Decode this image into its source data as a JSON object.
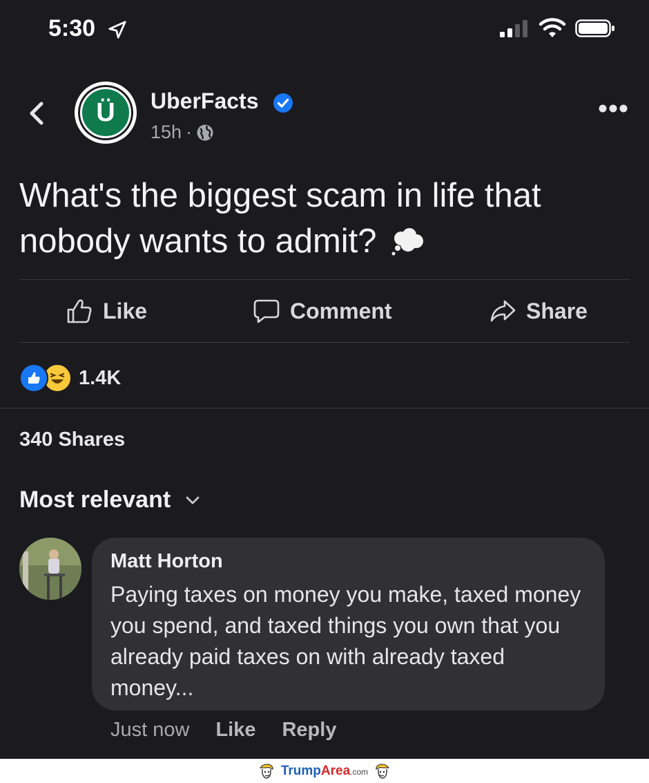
{
  "status_bar": {
    "time": "5:30"
  },
  "post": {
    "author": "UberFacts",
    "avatar_letter": "Ü",
    "time": "15h",
    "separator": "·",
    "text": "What's the biggest scam in life that nobody wants to admit?",
    "actions": {
      "like": "Like",
      "comment": "Comment",
      "share": "Share"
    },
    "reaction_count": "1.4K",
    "shares": "340 Shares",
    "sort_label": "Most relevant"
  },
  "comment": {
    "author": "Matt Horton",
    "text": "Paying taxes on money you make, taxed money you spend, and taxed things you own that you already paid taxes on with already taxed money...",
    "time": "Just now",
    "like": "Like",
    "reply": "Reply"
  },
  "watermark": {
    "brand_part1": "Trump",
    "brand_part2": "Area",
    "brand_suffix": ".com"
  },
  "colors": {
    "background": "#1b1a1f",
    "bubble": "#303035",
    "verified": "#1877f2",
    "avatar_green": "#0f7a4c"
  }
}
